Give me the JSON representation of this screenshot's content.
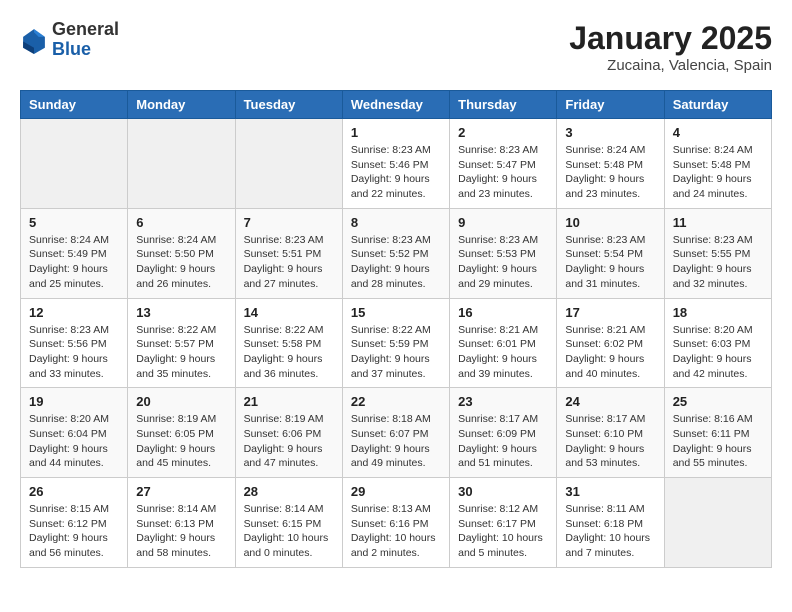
{
  "logo": {
    "general": "General",
    "blue": "Blue"
  },
  "header": {
    "month": "January 2025",
    "location": "Zucaina, Valencia, Spain"
  },
  "weekdays": [
    "Sunday",
    "Monday",
    "Tuesday",
    "Wednesday",
    "Thursday",
    "Friday",
    "Saturday"
  ],
  "weeks": [
    [
      {
        "day": "",
        "info": ""
      },
      {
        "day": "",
        "info": ""
      },
      {
        "day": "",
        "info": ""
      },
      {
        "day": "1",
        "info": "Sunrise: 8:23 AM\nSunset: 5:46 PM\nDaylight: 9 hours\nand 22 minutes."
      },
      {
        "day": "2",
        "info": "Sunrise: 8:23 AM\nSunset: 5:47 PM\nDaylight: 9 hours\nand 23 minutes."
      },
      {
        "day": "3",
        "info": "Sunrise: 8:24 AM\nSunset: 5:48 PM\nDaylight: 9 hours\nand 23 minutes."
      },
      {
        "day": "4",
        "info": "Sunrise: 8:24 AM\nSunset: 5:48 PM\nDaylight: 9 hours\nand 24 minutes."
      }
    ],
    [
      {
        "day": "5",
        "info": "Sunrise: 8:24 AM\nSunset: 5:49 PM\nDaylight: 9 hours\nand 25 minutes."
      },
      {
        "day": "6",
        "info": "Sunrise: 8:24 AM\nSunset: 5:50 PM\nDaylight: 9 hours\nand 26 minutes."
      },
      {
        "day": "7",
        "info": "Sunrise: 8:23 AM\nSunset: 5:51 PM\nDaylight: 9 hours\nand 27 minutes."
      },
      {
        "day": "8",
        "info": "Sunrise: 8:23 AM\nSunset: 5:52 PM\nDaylight: 9 hours\nand 28 minutes."
      },
      {
        "day": "9",
        "info": "Sunrise: 8:23 AM\nSunset: 5:53 PM\nDaylight: 9 hours\nand 29 minutes."
      },
      {
        "day": "10",
        "info": "Sunrise: 8:23 AM\nSunset: 5:54 PM\nDaylight: 9 hours\nand 31 minutes."
      },
      {
        "day": "11",
        "info": "Sunrise: 8:23 AM\nSunset: 5:55 PM\nDaylight: 9 hours\nand 32 minutes."
      }
    ],
    [
      {
        "day": "12",
        "info": "Sunrise: 8:23 AM\nSunset: 5:56 PM\nDaylight: 9 hours\nand 33 minutes."
      },
      {
        "day": "13",
        "info": "Sunrise: 8:22 AM\nSunset: 5:57 PM\nDaylight: 9 hours\nand 35 minutes."
      },
      {
        "day": "14",
        "info": "Sunrise: 8:22 AM\nSunset: 5:58 PM\nDaylight: 9 hours\nand 36 minutes."
      },
      {
        "day": "15",
        "info": "Sunrise: 8:22 AM\nSunset: 5:59 PM\nDaylight: 9 hours\nand 37 minutes."
      },
      {
        "day": "16",
        "info": "Sunrise: 8:21 AM\nSunset: 6:01 PM\nDaylight: 9 hours\nand 39 minutes."
      },
      {
        "day": "17",
        "info": "Sunrise: 8:21 AM\nSunset: 6:02 PM\nDaylight: 9 hours\nand 40 minutes."
      },
      {
        "day": "18",
        "info": "Sunrise: 8:20 AM\nSunset: 6:03 PM\nDaylight: 9 hours\nand 42 minutes."
      }
    ],
    [
      {
        "day": "19",
        "info": "Sunrise: 8:20 AM\nSunset: 6:04 PM\nDaylight: 9 hours\nand 44 minutes."
      },
      {
        "day": "20",
        "info": "Sunrise: 8:19 AM\nSunset: 6:05 PM\nDaylight: 9 hours\nand 45 minutes."
      },
      {
        "day": "21",
        "info": "Sunrise: 8:19 AM\nSunset: 6:06 PM\nDaylight: 9 hours\nand 47 minutes."
      },
      {
        "day": "22",
        "info": "Sunrise: 8:18 AM\nSunset: 6:07 PM\nDaylight: 9 hours\nand 49 minutes."
      },
      {
        "day": "23",
        "info": "Sunrise: 8:17 AM\nSunset: 6:09 PM\nDaylight: 9 hours\nand 51 minutes."
      },
      {
        "day": "24",
        "info": "Sunrise: 8:17 AM\nSunset: 6:10 PM\nDaylight: 9 hours\nand 53 minutes."
      },
      {
        "day": "25",
        "info": "Sunrise: 8:16 AM\nSunset: 6:11 PM\nDaylight: 9 hours\nand 55 minutes."
      }
    ],
    [
      {
        "day": "26",
        "info": "Sunrise: 8:15 AM\nSunset: 6:12 PM\nDaylight: 9 hours\nand 56 minutes."
      },
      {
        "day": "27",
        "info": "Sunrise: 8:14 AM\nSunset: 6:13 PM\nDaylight: 9 hours\nand 58 minutes."
      },
      {
        "day": "28",
        "info": "Sunrise: 8:14 AM\nSunset: 6:15 PM\nDaylight: 10 hours\nand 0 minutes."
      },
      {
        "day": "29",
        "info": "Sunrise: 8:13 AM\nSunset: 6:16 PM\nDaylight: 10 hours\nand 2 minutes."
      },
      {
        "day": "30",
        "info": "Sunrise: 8:12 AM\nSunset: 6:17 PM\nDaylight: 10 hours\nand 5 minutes."
      },
      {
        "day": "31",
        "info": "Sunrise: 8:11 AM\nSunset: 6:18 PM\nDaylight: 10 hours\nand 7 minutes."
      },
      {
        "day": "",
        "info": ""
      }
    ]
  ]
}
